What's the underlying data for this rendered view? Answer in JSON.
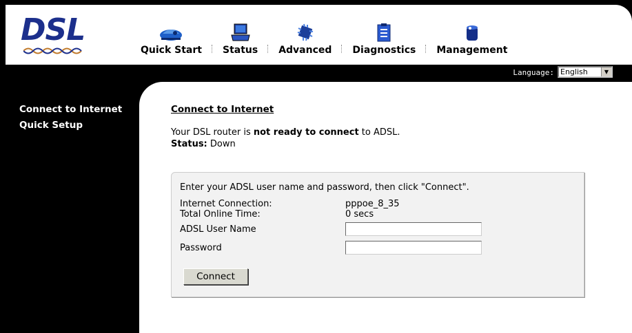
{
  "logo": {
    "text": "DSL"
  },
  "nav": [
    {
      "label": "Quick Start",
      "icon": "car-icon"
    },
    {
      "label": "Status",
      "icon": "laptop-icon"
    },
    {
      "label": "Advanced",
      "icon": "chip-icon"
    },
    {
      "label": "Diagnostics",
      "icon": "clipboard-icon"
    },
    {
      "label": "Management",
      "icon": "cylinder-icon"
    }
  ],
  "language": {
    "label": "Language:",
    "selected": "English"
  },
  "sidebar": {
    "items": [
      {
        "label": "Connect to Internet"
      },
      {
        "label": "Quick Setup"
      }
    ]
  },
  "main": {
    "title": "Connect to Internet",
    "status_prefix": "Your DSL router is ",
    "status_bold": "not ready to connect",
    "status_suffix": " to ADSL.",
    "status_label": "Status:",
    "status_value": " Down",
    "panel": {
      "instructions": "Enter your ADSL user name and password, then click \"Connect\".",
      "connection_label": "Internet Connection:",
      "connection_value": "pppoe_8_35",
      "online_label": "Total Online Time:",
      "online_value": "0 secs",
      "username_label": "ADSL User Name",
      "username_value": "",
      "password_label": "Password",
      "password_value": "",
      "connect_button": "Connect"
    }
  },
  "colors": {
    "logo": "#1c2f8c",
    "background": "#000000"
  }
}
